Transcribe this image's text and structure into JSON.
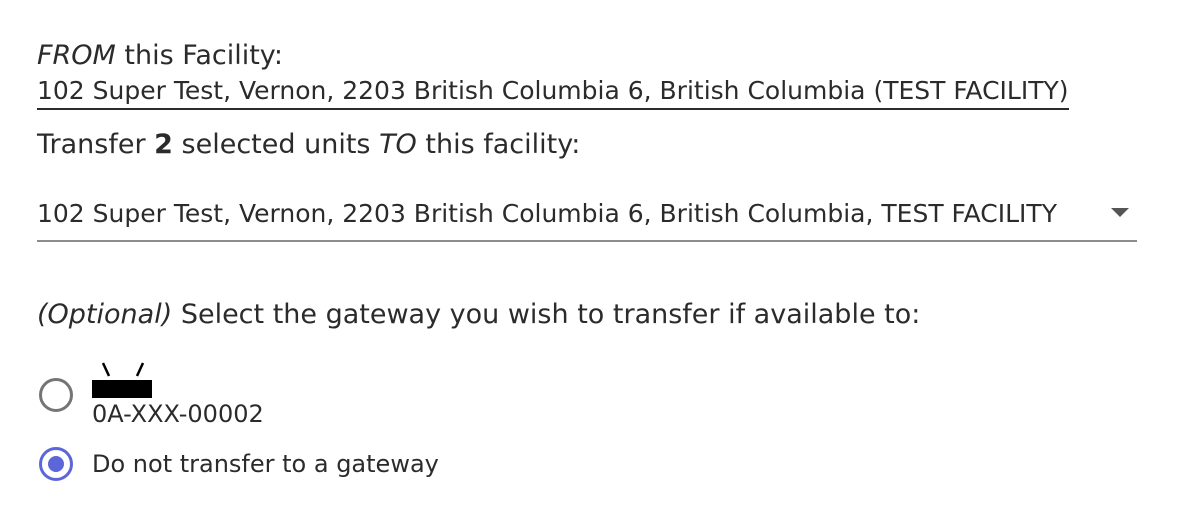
{
  "from": {
    "heading_italic": "FROM",
    "heading_rest": " this Facility:",
    "value": "102 Super Test, Vernon, 2203 British Columbia 6, British Columbia (TEST FACILITY)"
  },
  "transfer": {
    "prefix": "Transfer ",
    "count": "2",
    "middle": " selected units ",
    "to_italic": "TO",
    "suffix": " this facility:",
    "selected_value": "102 Super Test, Vernon, 2203 British Columbia 6, British Columbia, TEST FACILITY"
  },
  "gateway": {
    "optional_italic": "(Optional)",
    "heading_rest": " Select the gateway you wish to transfer if available to:",
    "options": [
      {
        "label": "0A-XXX-00002",
        "icon": "router-icon",
        "selected": false
      },
      {
        "label": "Do not transfer to a gateway",
        "selected": true
      }
    ]
  },
  "colors": {
    "accent": "#5b67d8",
    "text": "#2b2b2b",
    "radio_off": "#757575"
  }
}
